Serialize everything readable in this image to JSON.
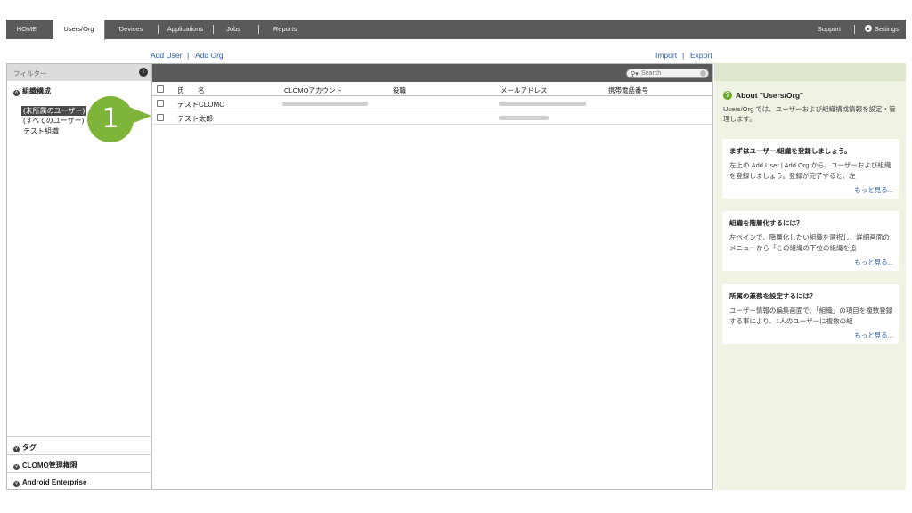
{
  "nav": {
    "items": [
      "HOME",
      "Users/Org",
      "Devices",
      "Applications",
      "Jobs",
      "Reports"
    ],
    "support": "Support",
    "settings": "Settings"
  },
  "actions": {
    "add_user": "Add User",
    "add_org": "Add Org",
    "import": "Import",
    "export": "Export",
    "sep": "|"
  },
  "filter": {
    "label": "フィルター",
    "org_section": "組織構成",
    "tree": [
      "(未所属のユーザー)",
      "(すべてのユーザー)",
      "テスト組織"
    ],
    "tag_section": "タグ",
    "clomo_section": "CLOMO管理権限",
    "android_section": "Android Enterprise"
  },
  "callout": {
    "number": "1",
    "color": "#7fb43a"
  },
  "search": {
    "placeholder": "Search"
  },
  "table": {
    "columns": {
      "name_1": "氏",
      "name_2": "名",
      "account": "CLOMOアカウント",
      "title": "役職",
      "email": "メールアドレス",
      "mobile": "携帯電話番号"
    },
    "rows": [
      {
        "name": "テストCLOMO"
      },
      {
        "name": "テスト太郎"
      }
    ]
  },
  "help": {
    "about_title": "About \"Users/Org\"",
    "about_desc": "Users/Org では、ユーザーおよび組織構成情報を設定・管理します。",
    "cards": [
      {
        "title": "まずはユーザー/組織を登録しましょう。",
        "body": "左上の Add User | Add Org から、ユーザーおよび組織を登録しましょう。登録が完了すると、左",
        "more": "もっと見る..."
      },
      {
        "title": "組織を階層化するには？",
        "body": "左ペインで、階層化したい組織を選択し、詳細画面のメニューから「この組織の下位の組織を追",
        "more": "もっと見る..."
      },
      {
        "title": "所属の兼務を設定するには？",
        "body": "ユーザー情報の編集画面で、「組織」の項目を複数登録する事により、1人のユーザーに複数の組",
        "more": "もっと見る..."
      }
    ]
  }
}
